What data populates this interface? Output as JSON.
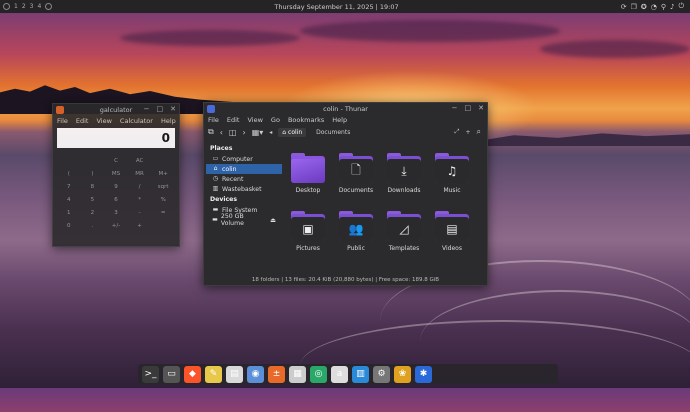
{
  "topbar": {
    "workspaces": [
      "1",
      "2",
      "3",
      "4"
    ],
    "datetime": "Thursday September 11, 2025 | 19:07",
    "tray_icons": [
      "update-icon",
      "notifications-icon",
      "accessibility-icon",
      "network-icon",
      "location-icon",
      "volume-icon",
      "power-icon"
    ]
  },
  "calculator": {
    "title": "galculator",
    "menu": [
      "File",
      "Edit",
      "View",
      "Calculator",
      "Help"
    ],
    "display": "0",
    "keys": [
      "",
      "",
      "C",
      "AC",
      "",
      "(",
      ")",
      "MS",
      "MR",
      "M+",
      "7",
      "8",
      "9",
      "/",
      "sqrt",
      "4",
      "5",
      "6",
      "*",
      "%",
      "1",
      "2",
      "3",
      "-",
      "=",
      "0",
      ".",
      "+/-",
      "+",
      ""
    ]
  },
  "thunar": {
    "title": "colin - Thunar",
    "menu": [
      "File",
      "Edit",
      "View",
      "Go",
      "Bookmarks",
      "Help"
    ],
    "path": [
      "colin",
      "Documents"
    ],
    "sidebar": {
      "places_label": "Places",
      "places": [
        {
          "label": "Computer",
          "icon": "computer-icon",
          "selected": false
        },
        {
          "label": "colin",
          "icon": "home-icon",
          "selected": true
        },
        {
          "label": "Recent",
          "icon": "clock-icon",
          "selected": false
        },
        {
          "label": "Wastebasket",
          "icon": "trash-icon",
          "selected": false
        }
      ],
      "devices_label": "Devices",
      "devices": [
        {
          "label": "File System",
          "icon": "drive-icon"
        },
        {
          "label": "250 GB Volume",
          "icon": "drive-icon"
        }
      ]
    },
    "items": [
      {
        "label": "Desktop",
        "glyph": ""
      },
      {
        "label": "Documents",
        "glyph": "🗋"
      },
      {
        "label": "Downloads",
        "glyph": "⤓"
      },
      {
        "label": "Music",
        "glyph": "♫"
      },
      {
        "label": "Pictures",
        "glyph": "▣"
      },
      {
        "label": "Public",
        "glyph": "👥"
      },
      {
        "label": "Templates",
        "glyph": "◿"
      },
      {
        "label": "Videos",
        "glyph": "▤"
      }
    ],
    "status": "18 folders | 13 files: 20.4 KiB (20,880 bytes) | Free space: 189.8 GiB"
  },
  "dock": [
    {
      "name": "terminal",
      "color": "#3a3a3a",
      "glyph": ">_"
    },
    {
      "name": "files",
      "color": "#555555",
      "glyph": "▭"
    },
    {
      "name": "brave",
      "color": "#fb542b",
      "glyph": "◆"
    },
    {
      "name": "text-editor",
      "color": "#e8c84a",
      "glyph": "✎"
    },
    {
      "name": "notes",
      "color": "#d9d9d9",
      "glyph": "▤"
    },
    {
      "name": "app-store",
      "color": "#5b8fd8",
      "glyph": "◉"
    },
    {
      "name": "calculator",
      "color": "#e86a2a",
      "glyph": "±"
    },
    {
      "name": "document-viewer",
      "color": "#cccccc",
      "glyph": "▦"
    },
    {
      "name": "screenshot",
      "color": "#2aa86a",
      "glyph": "◎"
    },
    {
      "name": "audio",
      "color": "#dddddd",
      "glyph": "a"
    },
    {
      "name": "system-monitor",
      "color": "#2a8ad8",
      "glyph": "▥"
    },
    {
      "name": "settings",
      "color": "#777777",
      "glyph": "⚙"
    },
    {
      "name": "photos",
      "color": "#e0a020",
      "glyph": "❀"
    },
    {
      "name": "bluetooth",
      "color": "#2a6ad8",
      "glyph": "✱"
    }
  ]
}
